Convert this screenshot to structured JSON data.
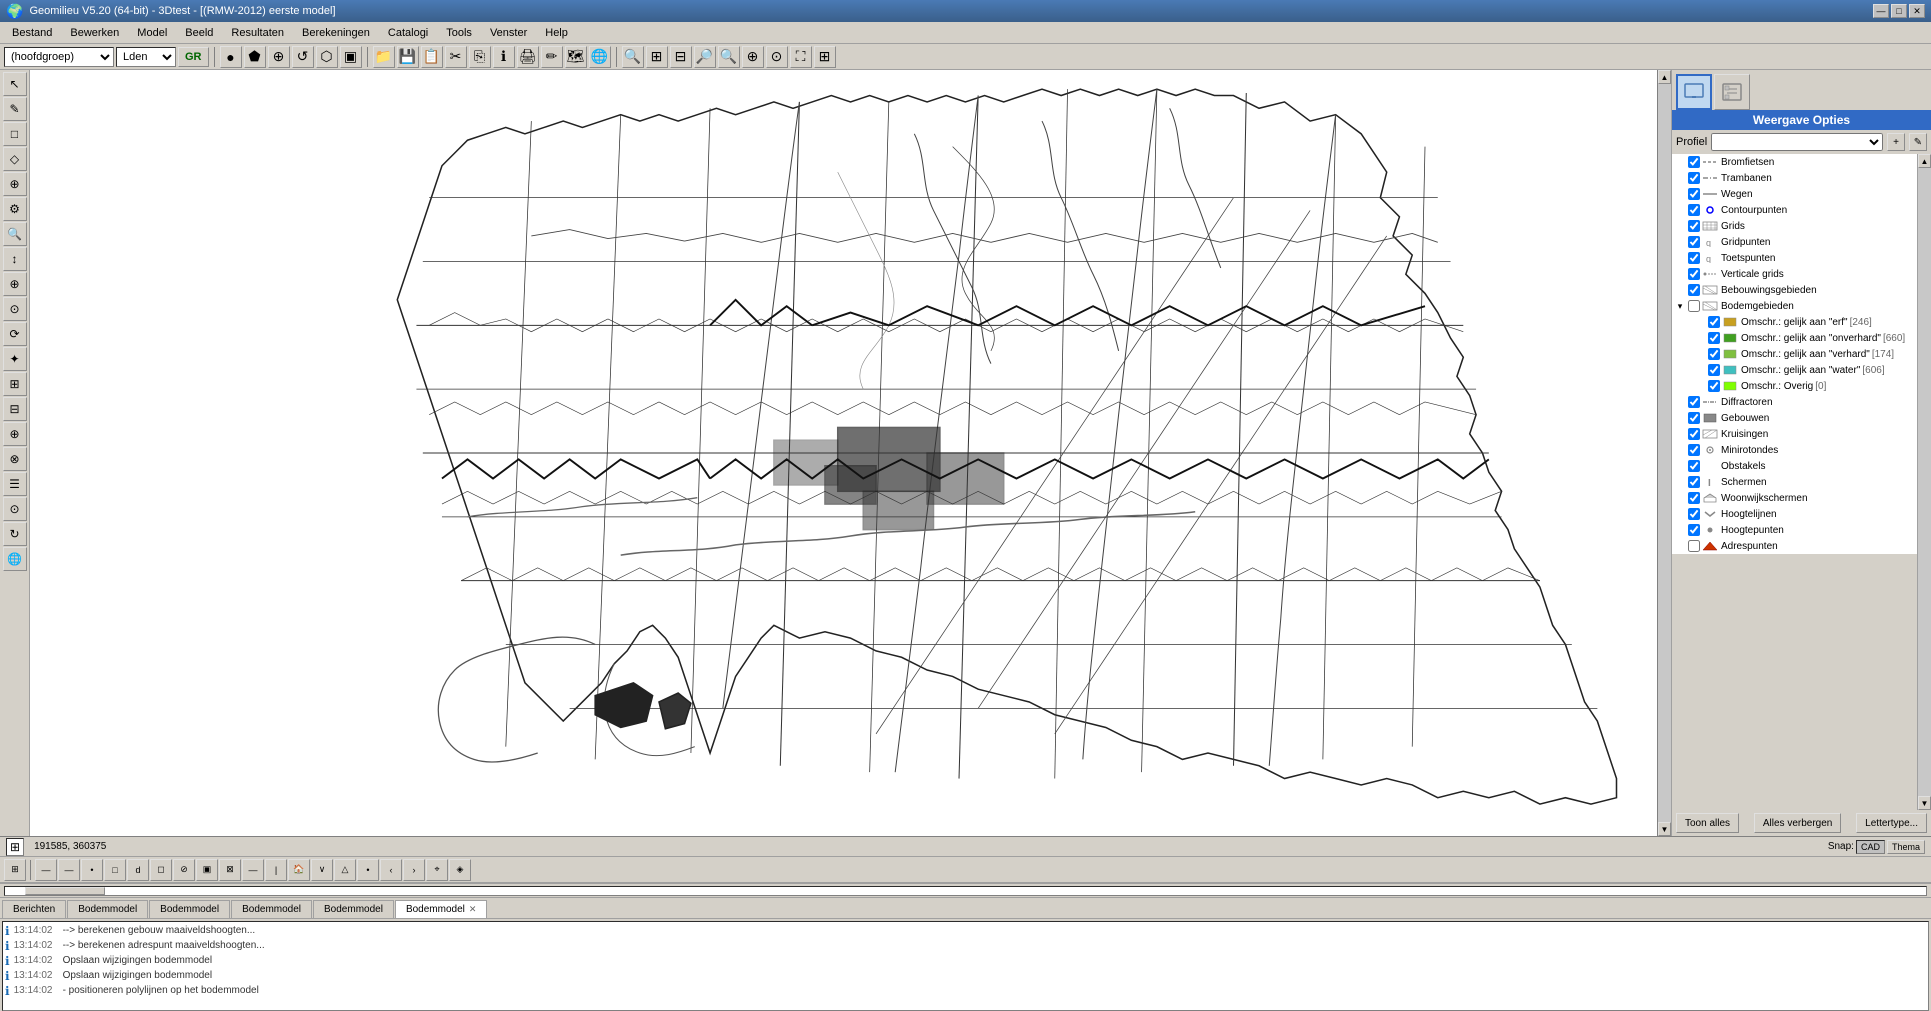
{
  "titleBar": {
    "title": "Geomilieu V5.20 (64-bit) - 3Dtest - [(RMW-2012) eerste model]",
    "minBtn": "—",
    "maxBtn": "□",
    "closeBtn": "✕"
  },
  "menuBar": {
    "items": [
      "Bestand",
      "Bewerken",
      "Model",
      "Beeld",
      "Resultaten",
      "Berekeningen",
      "Catalogi",
      "Tools",
      "Venster",
      "Help"
    ]
  },
  "toolbar": {
    "groupSelect": "(hoofdgroep)",
    "ldnSelect": "Lden",
    "grBtn": "GR"
  },
  "leftToolbar": {
    "buttons": [
      "↖",
      "✎",
      "□",
      "◇",
      "⌖",
      "⚙",
      "🔍",
      "↕",
      "⊕",
      "⊙",
      "⟳",
      "✦",
      "⊞",
      "⊟",
      "⊕",
      "⊗",
      "☰",
      "⊙",
      "↻"
    ]
  },
  "rightPanel": {
    "title": "Weergave Opties",
    "profielLabel": "Profiel",
    "layers": [
      {
        "name": "Bromfietsen",
        "checked": true,
        "icon": "line-dash",
        "iconColor": "#888888",
        "indent": 0
      },
      {
        "name": "Trambanen",
        "checked": true,
        "icon": "line-dotdash",
        "iconColor": "#888888",
        "indent": 0
      },
      {
        "name": "Wegen",
        "checked": true,
        "icon": "line-solid",
        "iconColor": "#888888",
        "indent": 0
      },
      {
        "name": "Contourpunten",
        "checked": true,
        "icon": "circle-blue",
        "iconColor": "#0000ff",
        "indent": 0
      },
      {
        "name": "Grids",
        "checked": true,
        "icon": "grid-pattern",
        "iconColor": "#888888",
        "indent": 0
      },
      {
        "name": "Gridpunten",
        "checked": true,
        "icon": "q-symbol",
        "iconColor": "#888888",
        "indent": 0
      },
      {
        "name": "Toetspunten",
        "checked": true,
        "icon": "q-symbol",
        "iconColor": "#888888",
        "indent": 0
      },
      {
        "name": "Verticale grids",
        "checked": true,
        "icon": "dot-dash",
        "iconColor": "#888888",
        "indent": 0
      },
      {
        "name": "Bebouwingsgebieden",
        "checked": true,
        "icon": "hatch-pattern",
        "iconColor": "#888888",
        "indent": 0
      },
      {
        "name": "Bodemgebieden",
        "checked": false,
        "icon": "hatch-pattern",
        "iconColor": "#888888",
        "indent": 0,
        "expanded": true
      },
      {
        "name": "Omschr.: gelijk aan \"erf\"",
        "checked": true,
        "icon": "square-yellow",
        "iconColor": "#c8a020",
        "indent": 1,
        "count": "[246]"
      },
      {
        "name": "Omschr.: gelijk aan \"onverhard\"",
        "checked": true,
        "icon": "square-green",
        "iconColor": "#40a020",
        "indent": 1,
        "count": "[660]"
      },
      {
        "name": "Omschr.: gelijk aan \"verhard\"",
        "checked": true,
        "icon": "square-green2",
        "iconColor": "#80c040",
        "indent": 1,
        "count": "[174]"
      },
      {
        "name": "Omschr.: gelijk aan \"water\"",
        "checked": true,
        "icon": "square-cyan",
        "iconColor": "#40c0c0",
        "indent": 1,
        "count": "[606]"
      },
      {
        "name": "Omschr.: Overig",
        "checked": true,
        "icon": "square-lime",
        "iconColor": "#80ff00",
        "indent": 1,
        "count": "[0]"
      },
      {
        "name": "Diffractoren",
        "checked": true,
        "icon": "line-pattern",
        "iconColor": "#888888",
        "indent": 0
      },
      {
        "name": "Gebouwen",
        "checked": true,
        "icon": "square-filled",
        "iconColor": "#888888",
        "indent": 0
      },
      {
        "name": "Kruisingen",
        "checked": true,
        "icon": "hatch2",
        "iconColor": "#888888",
        "indent": 0
      },
      {
        "name": "Minirotondes",
        "checked": true,
        "icon": "circle-pattern",
        "iconColor": "#888888",
        "indent": 0
      },
      {
        "name": "Obstakels",
        "checked": true,
        "icon": "none",
        "iconColor": "#888888",
        "indent": 0
      },
      {
        "name": "Schermen",
        "checked": true,
        "icon": "I-beam",
        "iconColor": "#888888",
        "indent": 0
      },
      {
        "name": "Woonwijkschermen",
        "checked": true,
        "icon": "house-pattern",
        "iconColor": "#888888",
        "indent": 0
      },
      {
        "name": "Hoogtelijnen",
        "checked": true,
        "icon": "chevron-down",
        "iconColor": "#888888",
        "indent": 0
      },
      {
        "name": "Hoogtepunten",
        "checked": true,
        "icon": "dot",
        "iconColor": "#888888",
        "indent": 0
      },
      {
        "name": "Adrespunten",
        "checked": false,
        "icon": "triangle-red",
        "iconColor": "#cc0000",
        "indent": 0
      }
    ],
    "bottomBtns": [
      "Toon alles",
      "Alles verbergen",
      "Lettertype..."
    ]
  },
  "statusBar": {
    "coords": "191585, 360375",
    "snapLabel": "Snap:",
    "cadBtn": "CAD",
    "themeBtn": "Thema"
  },
  "bottomTabs": {
    "tabs": [
      {
        "label": "Berichten",
        "closeable": false
      },
      {
        "label": "Bodemmodel",
        "closeable": false
      },
      {
        "label": "Bodemmodel",
        "closeable": false
      },
      {
        "label": "Bodemmodel",
        "closeable": false
      },
      {
        "label": "Bodemmodel",
        "closeable": false
      },
      {
        "label": "Bodemmodel",
        "closeable": true,
        "active": true
      }
    ]
  },
  "logMessages": [
    {
      "time": "13:14:02",
      "msg": "--> berekenen gebouw maaiveldshoogten..."
    },
    {
      "time": "13:14:02",
      "msg": "--> berekenen adrespunt maaiveldshoogten..."
    },
    {
      "time": "13:14:02",
      "msg": "Opslaan wijzigingen bodemmodel"
    },
    {
      "time": "13:14:02",
      "msg": "Opslaan wijzigingen bodemmodel"
    },
    {
      "time": "13:14:02",
      "msg": "- positioneren polylijnen op het bodemmodel"
    }
  ]
}
